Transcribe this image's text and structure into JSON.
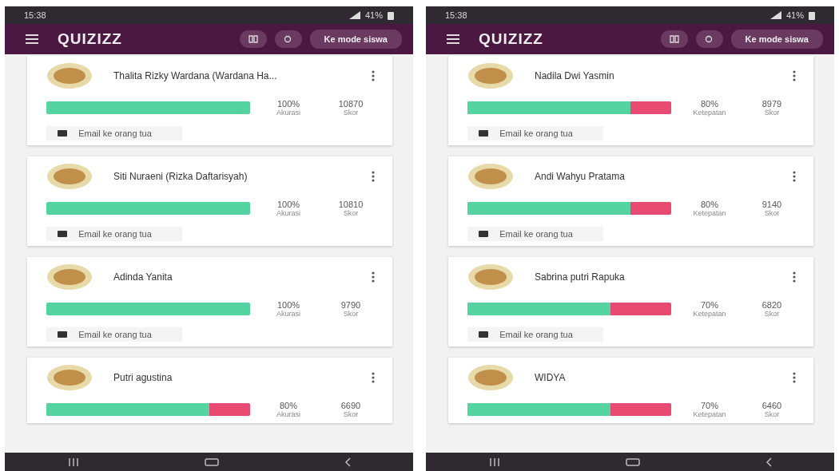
{
  "phones": [
    {
      "status_time": "15:38",
      "battery": "41%",
      "header": {
        "logo": "QUIZIZZ",
        "mode_button": "Ke mode siswa"
      },
      "students": [
        {
          "name": "Thalita Rizky Wardana (Wardana Ha...",
          "level": 1,
          "percent": "100%",
          "percent_label": "Akurasi",
          "score": "10870",
          "score_label": "Skor",
          "email_button": "Email ke orang tua"
        },
        {
          "name": "Siti Nuraeni (Rizka Daftarisyah)",
          "level": 1,
          "percent": "100%",
          "percent_label": "Akurasi",
          "score": "10810",
          "score_label": "Skor",
          "email_button": "Email ke orang tua"
        },
        {
          "name": "Adinda Yanita",
          "level": 1,
          "percent": "100%",
          "percent_label": "Akurasi",
          "score": "9790",
          "score_label": "Skor",
          "email_button": "Email ke orang tua"
        },
        {
          "name": "Putri agustina",
          "level": 0.8,
          "percent": "80%",
          "percent_label": "Akurasi",
          "score": "6690",
          "score_label": "Skor"
        }
      ]
    },
    {
      "status_time": "15:38",
      "battery": "41%",
      "header": {
        "logo": "QUIZIZZ",
        "mode_button": "Ke mode siswa"
      },
      "students": [
        {
          "name": "Nadila Dwi Yasmin",
          "level": 0.8,
          "percent": "80%",
          "percent_label": "Ketepatan",
          "score": "8979",
          "score_label": "Skor",
          "email_button": "Email ke orang tua"
        },
        {
          "name": "Andi Wahyu Pratama",
          "level": 0.8,
          "percent": "80%",
          "percent_label": "Ketepatan",
          "score": "9140",
          "score_label": "Skor",
          "email_button": "Email ke orang tua"
        },
        {
          "name": "Sabrina putri Rapuka",
          "level": 0.7,
          "percent": "70%",
          "percent_label": "Ketepatan",
          "score": "6820",
          "score_label": "Skor",
          "email_button": "Email ke orang tua"
        },
        {
          "name": "WIDYA",
          "level": 0.7,
          "percent": "70%",
          "percent_label": "Ketepatan",
          "score": "6460",
          "score_label": "Skor"
        }
      ]
    }
  ]
}
